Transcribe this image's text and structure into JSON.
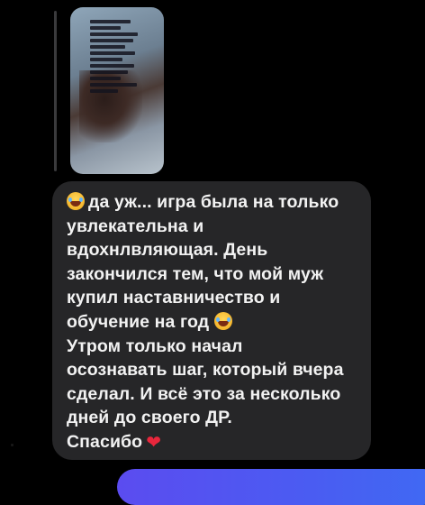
{
  "message": {
    "lines": [
      {
        "emoji_before": "face-with-tears-of-joy",
        "text": "да уж... игра была на только"
      },
      {
        "text": "увлекательна и"
      },
      {
        "text": "вдохнлвляющая. День"
      },
      {
        "text": "закончился тем, что мой муж"
      },
      {
        "text": "купил наставничество и"
      },
      {
        "text": "обучение на год",
        "emoji_after": "face-with-tears-of-joy"
      },
      {
        "text": "Утром только начал"
      },
      {
        "text": "осознавать шаг, который вчера"
      },
      {
        "text": "сделал. И всё это за несколько"
      },
      {
        "text": "дней до своего ДР."
      },
      {
        "text": "Спасибо",
        "emoji_after": "red-heart"
      }
    ]
  },
  "colors": {
    "background": "#000000",
    "incoming_bubble": "#262628",
    "text": "#f2f2f2",
    "outgoing_bubble": "#4a5cf2"
  }
}
